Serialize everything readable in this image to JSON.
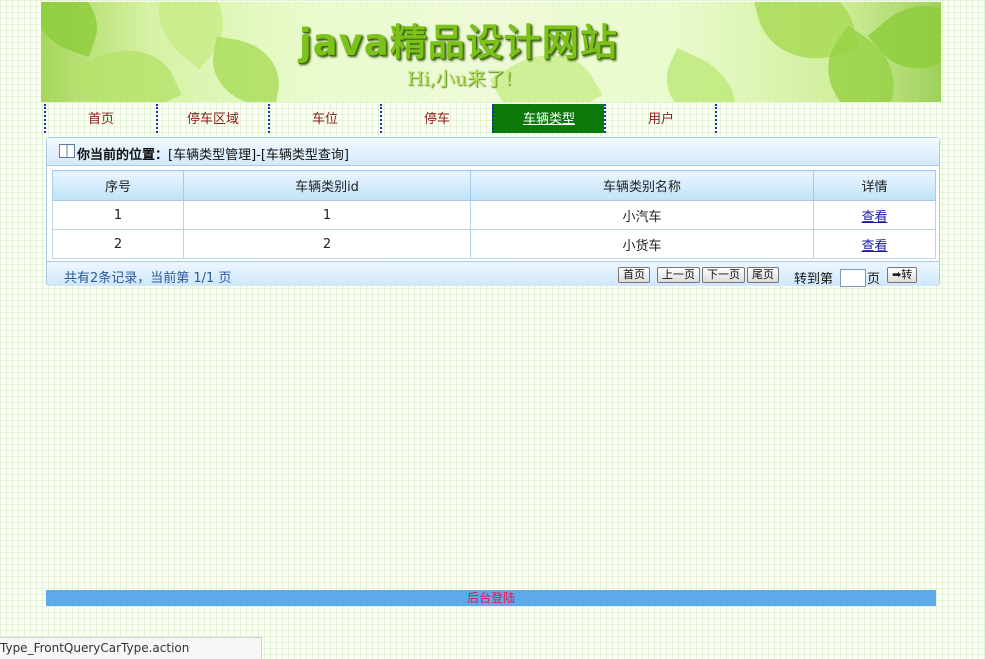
{
  "banner": {
    "title": "java精品设计网站",
    "subtitle": "Hi,小u来了!"
  },
  "nav": {
    "items": [
      {
        "label": "首页"
      },
      {
        "label": "停车区域"
      },
      {
        "label": "车位"
      },
      {
        "label": "停车"
      },
      {
        "label": "车辆类型",
        "active": true
      },
      {
        "label": "用户"
      }
    ]
  },
  "breadcrumb": {
    "prefix": "你当前的位置：",
    "path": "[车辆类型管理]-[车辆类型查询]"
  },
  "table": {
    "headers": [
      "序号",
      "车辆类别id",
      "车辆类别名称",
      "详情"
    ],
    "rows": [
      {
        "index": "1",
        "id": "1",
        "name": "小汽车",
        "action": "查看"
      },
      {
        "index": "2",
        "id": "2",
        "name": "小货车",
        "action": "查看"
      }
    ]
  },
  "pagination": {
    "summary": "共有2条记录，当前第 1/1 页",
    "first": "首页",
    "prev": "上一页",
    "next": "下一页",
    "last": "尾页",
    "goto_label": "转到第",
    "goto_value": "",
    "goto_unit": "页",
    "go_button": "➡转"
  },
  "footer": {
    "admin_login": "后台登陆"
  },
  "status_bar": {
    "url": "Type_FrontQueryCarType.action"
  },
  "colors": {
    "nav_active_bg": "#0b7a0b",
    "nav_text": "#8b1a1a",
    "footer_bar": "#5ea9ea",
    "footer_text": "#e0194b"
  }
}
